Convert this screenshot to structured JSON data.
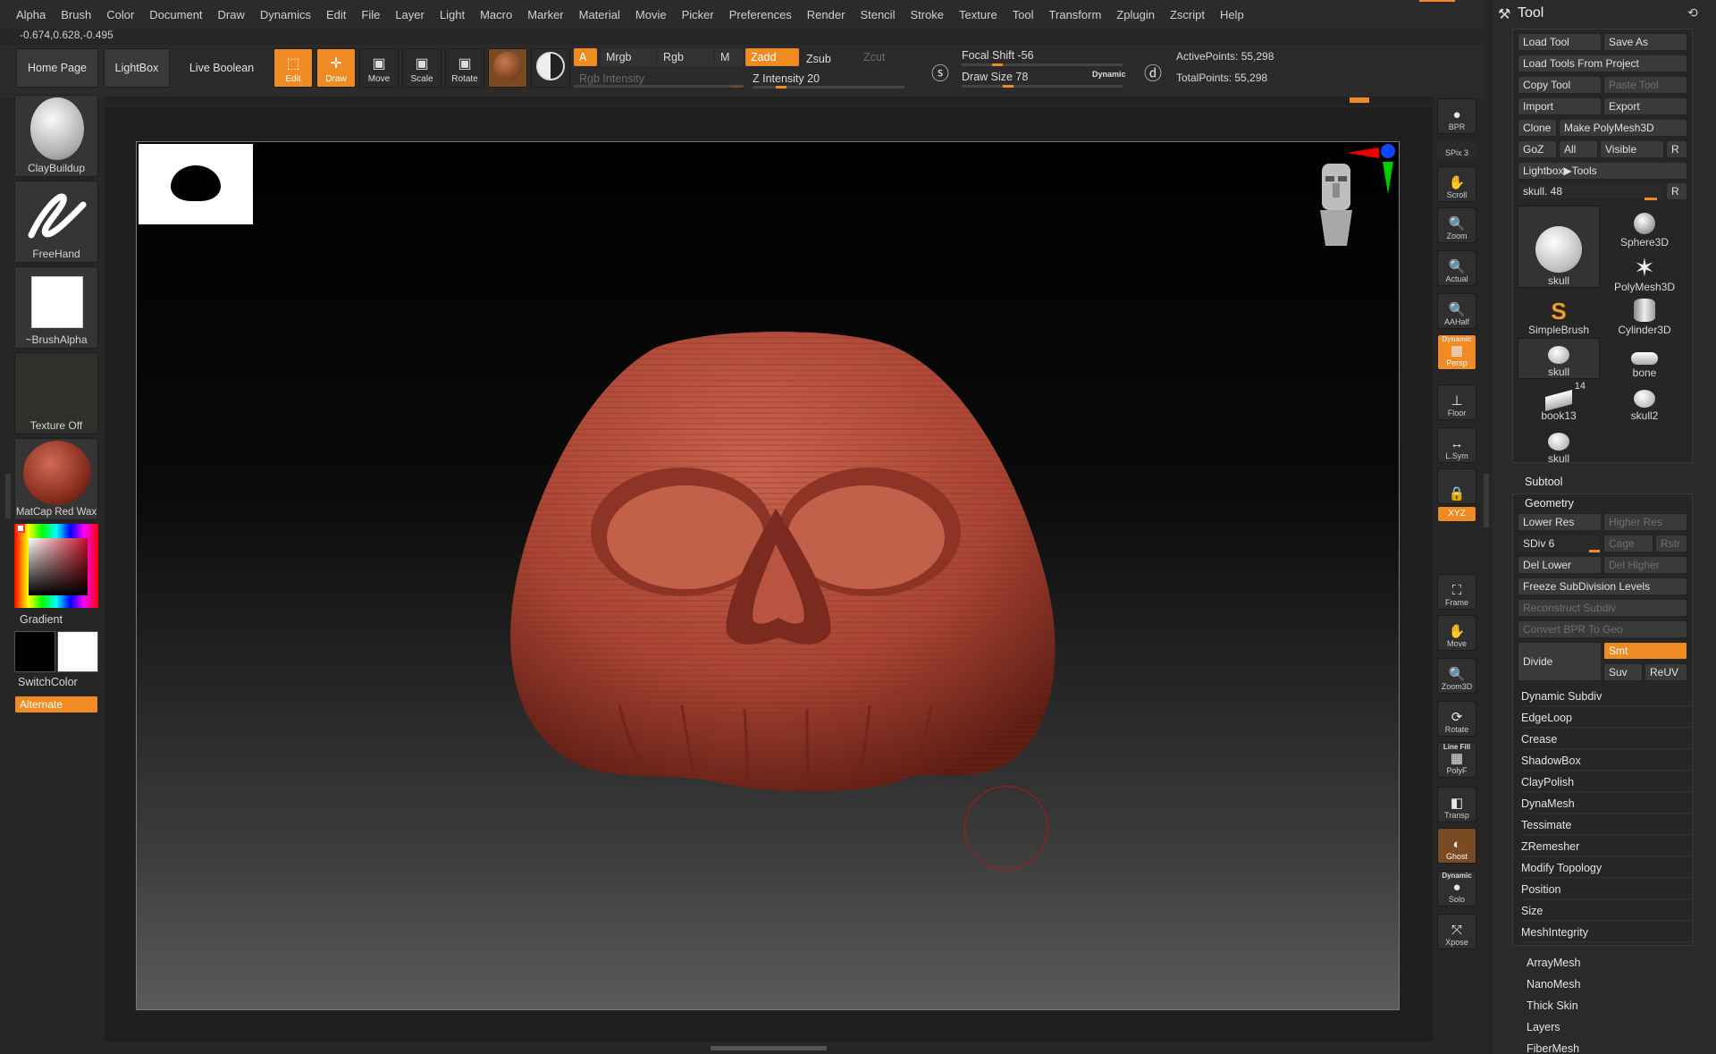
{
  "menu": [
    "Alpha",
    "Brush",
    "Color",
    "Document",
    "Draw",
    "Dynamics",
    "Edit",
    "File",
    "Layer",
    "Light",
    "Macro",
    "Marker",
    "Material",
    "Movie",
    "Picker",
    "Preferences",
    "Render",
    "Stencil",
    "Stroke",
    "Texture",
    "Tool",
    "Transform",
    "Zplugin",
    "Zscript",
    "Help"
  ],
  "coords": "-0.674,0.628,-0.495",
  "nav": {
    "home": "Home Page",
    "lightbox": "LightBox",
    "live_boolean": "Live Boolean"
  },
  "modes": {
    "edit": "Edit",
    "draw": "Draw",
    "move": "Move",
    "scale": "Scale",
    "rotate": "Rotate"
  },
  "color_modes": {
    "a": "A",
    "mrgb": "Mrgb",
    "rgb": "Rgb",
    "m": "M",
    "rgb_intensity": "Rgb Intensity"
  },
  "z_modes": {
    "zadd": "Zadd",
    "zsub": "Zsub",
    "zcut": "Zcut",
    "z_intensity": "Z Intensity 20",
    "z_intensity_value": 20
  },
  "focal": {
    "label": "Focal Shift -56",
    "value": -56
  },
  "draw_size": {
    "label": "Draw Size 78",
    "value": 78,
    "dynamic": "Dynamic"
  },
  "points": {
    "active": "ActivePoints: 55,298",
    "total": "TotalPoints: 55,298"
  },
  "shelf": {
    "brush": "ClayBuildup",
    "stroke": "FreeHand",
    "alpha": "~BrushAlpha",
    "texture": "Texture Off",
    "material": "MatCap Red Wax",
    "gradient": "Gradient",
    "switch_color": "SwitchColor",
    "alternate": "Alternate"
  },
  "right_shelf": [
    {
      "id": "bpr",
      "label": "BPR",
      "glyph": "●"
    },
    {
      "id": "spix",
      "label": "SPix 3"
    },
    {
      "id": "scroll",
      "label": "Scroll",
      "glyph": "✋"
    },
    {
      "id": "zoom",
      "label": "Zoom",
      "glyph": "🔍"
    },
    {
      "id": "actual",
      "label": "Actual",
      "glyph": "🔍"
    },
    {
      "id": "aahalf",
      "label": "AAHalf",
      "glyph": "🔍"
    },
    {
      "id": "persp",
      "label": "Persp",
      "glyph": "▦",
      "top": "Dynamic"
    },
    {
      "id": "floor",
      "label": "Floor",
      "glyph": "⊥"
    },
    {
      "id": "lsym",
      "label": "L.Sym",
      "glyph": "↔"
    },
    {
      "id": "lock",
      "label": "",
      "glyph": "🔒"
    },
    {
      "id": "xyz",
      "label": "XYZ"
    },
    {
      "id": "frame",
      "label": "Frame",
      "glyph": "⛶"
    },
    {
      "id": "move",
      "label": "Move",
      "glyph": "✋"
    },
    {
      "id": "zoom3d",
      "label": "Zoom3D",
      "glyph": "🔍"
    },
    {
      "id": "rotate",
      "label": "Rotate",
      "glyph": "⟳"
    },
    {
      "id": "polyf",
      "label": "PolyF",
      "glyph": "▦",
      "top": "Line Fill"
    },
    {
      "id": "transp",
      "label": "Transp",
      "glyph": "◧"
    },
    {
      "id": "ghost",
      "label": "Ghost",
      "glyph": "◐"
    },
    {
      "id": "solo",
      "label": "Solo",
      "glyph": "●",
      "top": "Dynamic"
    },
    {
      "id": "xpose",
      "label": "Xpose",
      "glyph": "⤧"
    }
  ],
  "tool": {
    "title": "Tool",
    "buttons": {
      "load_tool": "Load Tool",
      "save_as": "Save As",
      "load_from_project": "Load Tools From Project",
      "copy_tool": "Copy Tool",
      "paste_tool": "Paste Tool",
      "import": "Import",
      "export": "Export",
      "clone": "Clone",
      "make_polymesh": "Make PolyMesh3D",
      "goz": "GoZ",
      "all": "All",
      "visible": "Visible",
      "r": "R",
      "lightbox_tools": "Lightbox▶Tools"
    },
    "current": "skull. 48",
    "thumbs": [
      {
        "name": "skull"
      },
      {
        "name": "Sphere3D"
      },
      {
        "name": "PolyMesh3D"
      },
      {
        "name": "SimpleBrush"
      },
      {
        "name": "Cylinder3D"
      },
      {
        "name": "skull"
      },
      {
        "name": "bone"
      },
      {
        "name": "book13",
        "badge": "14"
      },
      {
        "name": "skull2"
      },
      {
        "name": "skull"
      }
    ],
    "subtool": "Subtool",
    "geometry": {
      "title": "Geometry",
      "lower_res": "Lower Res",
      "higher_res": "Higher Res",
      "sdiv": "SDiv 6",
      "cage": "Cage",
      "rstr": "Rstr",
      "del_lower": "Del Lower",
      "del_higher": "Del Higher",
      "freeze": "Freeze SubDivision Levels",
      "reconstruct": "Reconstruct Subdiv",
      "convert_bpr": "Convert BPR To Geo",
      "divide": "Divide",
      "smt": "Smt",
      "suv": "Suv",
      "reuv": "ReUV",
      "items": [
        "Dynamic Subdiv",
        "EdgeLoop",
        "Crease",
        "ShadowBox",
        "ClayPolish",
        "DynaMesh",
        "Tessimate",
        "ZRemesher",
        "Modify Topology",
        "Position",
        "Size",
        "MeshIntegrity"
      ]
    },
    "bottom_items": [
      "ArrayMesh",
      "NanoMesh",
      "Thick Skin",
      "Layers",
      "FiberMesh"
    ]
  },
  "colors": {
    "accent": "#f08b24",
    "panel": "#2a2a2a",
    "mesh": "#b5503e"
  }
}
